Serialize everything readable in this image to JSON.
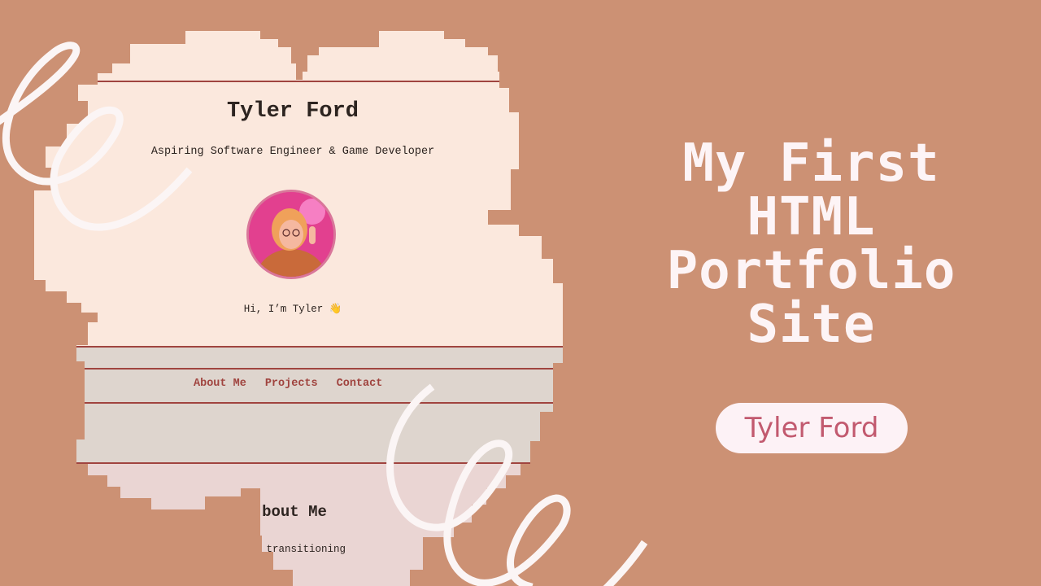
{
  "portfolio_preview": {
    "site_title": "Tyler Ford",
    "subtitle": "Aspiring Software Engineer & Game Developer",
    "greeting": "Hi, I’m Tyler 👋",
    "nav": [
      "About Me",
      "Projects",
      "Contact"
    ],
    "about_heading": "bout Me",
    "about_text": "ly transitioning"
  },
  "hero": {
    "title_lines": [
      "My First",
      "HTML",
      "Portfolio",
      "Site"
    ],
    "author_pill": "Tyler Ford"
  },
  "colors": {
    "background": "#cc9174",
    "header_bg": "#fbe8dd",
    "accent_red": "#a0443f",
    "pill_text": "#c25a6f",
    "hero_text": "#fdf4f6"
  }
}
